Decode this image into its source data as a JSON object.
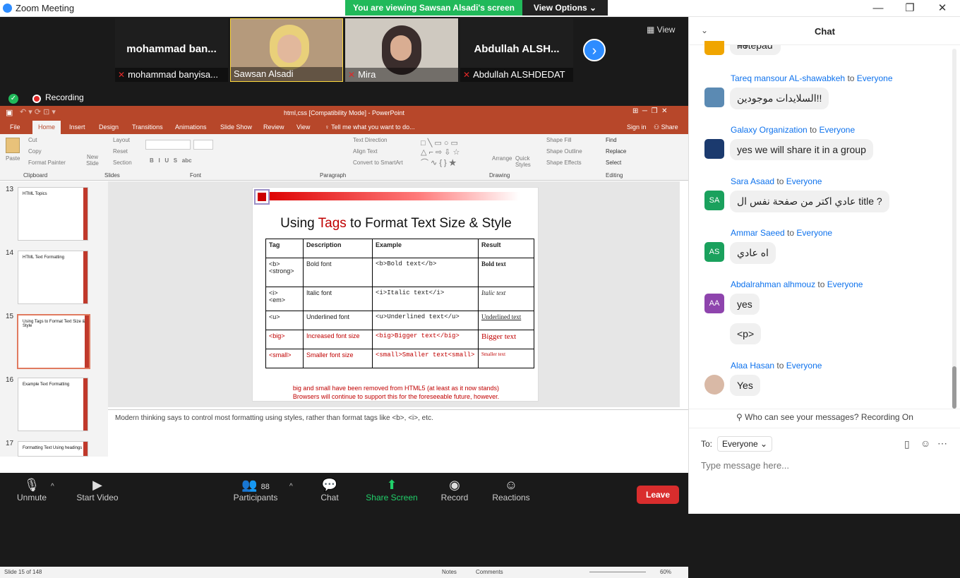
{
  "window": {
    "title": "Zoom Meeting",
    "minimize": "—",
    "maximize": "❐",
    "close": "✕"
  },
  "banner": {
    "viewing": "You are viewing Sawsan Alsadi's screen",
    "view_options": "View Options ⌄"
  },
  "participants_strip": {
    "tiles": [
      {
        "display": "mohammad  ban...",
        "name": "mohammad banyisa..."
      },
      {
        "display": "",
        "name": "Sawsan Alsadi"
      },
      {
        "display": "",
        "name": "Mira"
      },
      {
        "display": "Abdullah  ALSH...",
        "name": "Abdullah ALSHDEDAT"
      }
    ],
    "next": "›",
    "view_label": "View"
  },
  "recording": {
    "label": "Recording"
  },
  "powerpoint": {
    "title": "html,css [Compatibility Mode] - PowerPoint",
    "tabs": [
      "File",
      "Home",
      "Insert",
      "Design",
      "Transitions",
      "Animations",
      "Slide Show",
      "Review",
      "View"
    ],
    "tell_me": "Tell me what you want to do...",
    "sign_in": "Sign in",
    "share": "Share",
    "groups": [
      "Clipboard",
      "Slides",
      "Font",
      "Paragraph",
      "Drawing",
      "Editing"
    ],
    "ribbon": {
      "paste": "Paste",
      "cut": "Cut",
      "copy": "Copy",
      "format_painter": "Format Painter",
      "new_slide": "New Slide",
      "layout": "Layout",
      "reset": "Reset",
      "section": "Section",
      "text_direction": "Text Direction",
      "align_text": "Align Text",
      "convert": "Convert to SmartArt",
      "arrange": "Arrange",
      "quick_styles": "Quick Styles",
      "shape_fill": "Shape Fill",
      "shape_outline": "Shape Outline",
      "shape_effects": "Shape Effects",
      "find": "Find",
      "replace": "Replace",
      "select": "Select"
    },
    "thumbnails": [
      {
        "num": "13",
        "title": "HTML Topics"
      },
      {
        "num": "14",
        "title": "HTML Text Formatting"
      },
      {
        "num": "15",
        "title": "Using Tags to Format Text Size & Style"
      },
      {
        "num": "16",
        "title": "Example Text Formatting"
      },
      {
        "num": "17",
        "title": "Formatting Text Using headings"
      }
    ],
    "slide": {
      "title_pre": "Using ",
      "title_red": "Tags",
      "title_post": " to Format Text Size & Style",
      "headers": [
        "Tag",
        "Description",
        "Example",
        "Result"
      ],
      "rows": [
        {
          "tag": "<b>\n<strong>",
          "desc": "Bold font",
          "example": "<b>Bold text</b>",
          "result": "Bold text"
        },
        {
          "tag": "<i>\n<em>",
          "desc": "Italic font",
          "example": "<i>Italic text</i>",
          "result": "Italic text"
        },
        {
          "tag": "<u>",
          "desc": "Underlined font",
          "example": "<u>Underlined text</u>",
          "result": "Underlined text"
        },
        {
          "tag": "<big>",
          "desc": "Increased font size",
          "example": "<big>Bigger text</big>",
          "result": "Bigger text"
        },
        {
          "tag": "<small>",
          "desc": "Smaller font size",
          "example": "<small>Smaller text<small>",
          "result": "Smaller text"
        }
      ],
      "footer1": "big and small have been removed from HTML5 (at least as it now stands)",
      "footer2": "Browsers will continue to support this for the foreseeable future, however."
    },
    "notes": "Modern thinking says to control most formatting using styles, rather than format tags like <b>, <i>, etc.",
    "status": {
      "slide": "Slide 15 of 148",
      "notes": "Notes",
      "comments": "Comments",
      "zoom": "60%"
    }
  },
  "toolbar": {
    "unmute": "Unmute",
    "start_video": "Start Video",
    "participants": "Participants",
    "participants_count": "88",
    "chat": "Chat",
    "share_screen": "Share Screen",
    "record": "Record",
    "reactions": "Reactions",
    "leave": "Leave"
  },
  "chat": {
    "title": "Chat",
    "partial_message": "notepad ++",
    "messages": [
      {
        "sender": "Tareq mansour AL-shawabkeh",
        "to": "to",
        "target": "Everyone",
        "avatar": "",
        "text": "السلايدات موجودين!!"
      },
      {
        "sender": "Galaxy Organization",
        "to": "to",
        "target": "Everyone",
        "avatar": "",
        "text": "yes we will share it in a group"
      },
      {
        "sender": "Sara Asaad",
        "to": "to",
        "target": "Everyone",
        "avatar": "SA",
        "text": "عادي اكتر من صفحة نفس ال title ?"
      },
      {
        "sender": "Ammar Saeed",
        "to": "to",
        "target": "Everyone",
        "avatar": "AS",
        "text": "اه عادي"
      },
      {
        "sender": "Abdalrahman alhmouz",
        "to": "to",
        "target": "Everyone",
        "avatar": "AA",
        "text": "yes",
        "text2": "<p>"
      },
      {
        "sender": "Alaa Hasan",
        "to": "to",
        "target": "Everyone",
        "avatar": "",
        "text": "Yes"
      }
    ],
    "who_can_see": "Who can see your messages? Recording On",
    "to_label": "To:",
    "to_value": "Everyone",
    "placeholder": "Type message here...",
    "colors": {
      "link": "#0e72ed",
      "sa": "#1aa15d",
      "as": "#1aa15d",
      "aa": "#8e44ad"
    }
  }
}
